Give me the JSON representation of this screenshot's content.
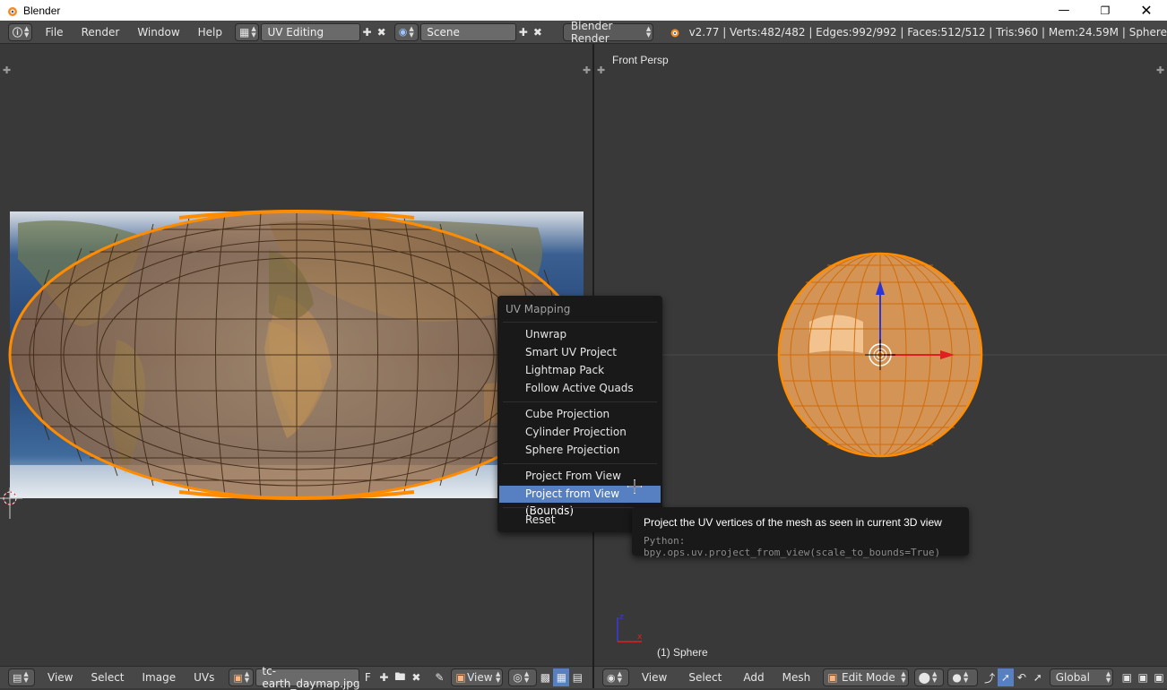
{
  "window": {
    "title": "Blender"
  },
  "info_header": {
    "menus": [
      "File",
      "Render",
      "Window",
      "Help"
    ],
    "screen_layout": "UV Editing",
    "scene": "Scene",
    "render_engine": "Blender Render",
    "stats": "v2.77 | Verts:482/482 | Edges:992/992 | Faces:512/512 | Tris:960 | Mem:24.59M | Sphere"
  },
  "view3d": {
    "view_label": "Front Persp",
    "object_label": "(1) Sphere"
  },
  "uv_menu": {
    "title": "UV Mapping",
    "items": [
      "Unwrap",
      "Smart UV Project",
      "Lightmap Pack",
      "Follow Active Quads",
      "Cube Projection",
      "Cylinder Projection",
      "Sphere Projection",
      "Project From View",
      "Project from View (Bounds)",
      "Reset"
    ],
    "active_item": "Project from View (Bounds)"
  },
  "tooltip": {
    "description": "Project the UV vertices of the mesh as seen in current 3D view",
    "python": "Python: bpy.ops.uv.project_from_view(scale_to_bounds=True)"
  },
  "uv_header": {
    "menus": [
      "View",
      "Select",
      "Image",
      "UVs"
    ],
    "image_name": "tc-earth_daymap.jpg",
    "fake_user": "F",
    "view_label": "View"
  },
  "view3d_header": {
    "menus": [
      "View",
      "Select",
      "Add",
      "Mesh"
    ],
    "mode": "Edit Mode",
    "orientation": "Global"
  },
  "colors": {
    "menu_highlight": "#5680c2",
    "mesh_orange": "#ff8c00",
    "background": "#393939"
  }
}
